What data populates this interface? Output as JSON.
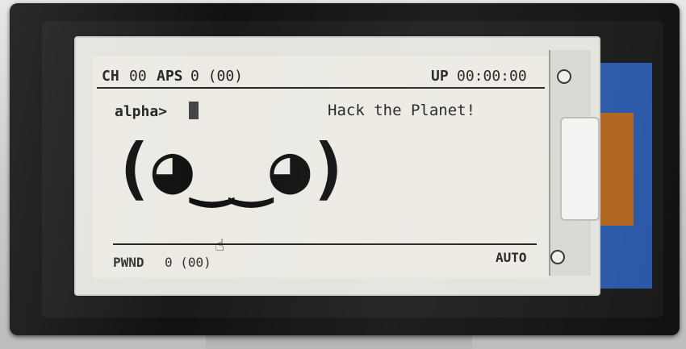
{
  "top": {
    "ch_label": "CH",
    "ch_value": "00",
    "aps_label": "APS",
    "aps_value": "0 (00)",
    "up_label": "UP",
    "up_value": "00:00:00"
  },
  "status": {
    "name": "alpha>",
    "message": "Hack the Planet!"
  },
  "face": "(◕‿‿◕)",
  "bottom": {
    "pwnd_label": "PWND",
    "pwnd_value": "0 (00)",
    "mode": "AUTO"
  }
}
